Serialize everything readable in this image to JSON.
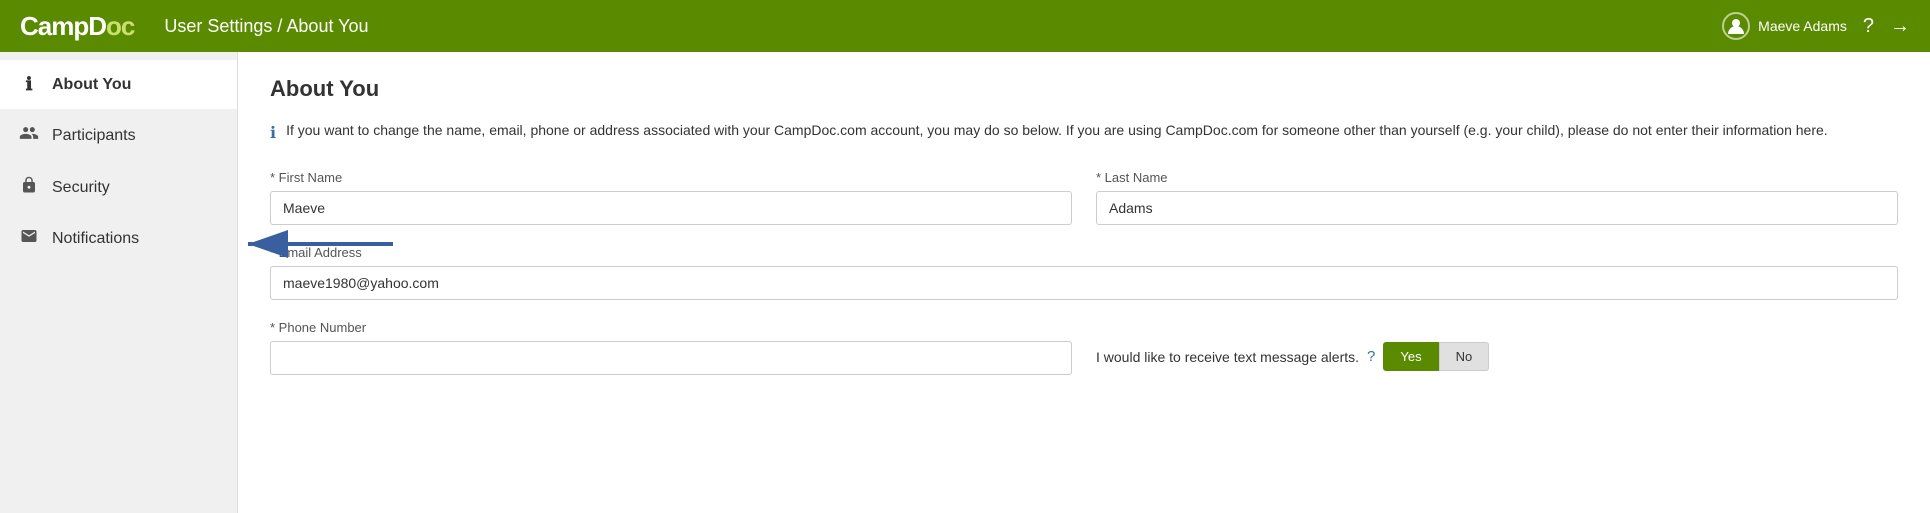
{
  "header": {
    "logo_camp": "CampD",
    "logo_doc": "oc",
    "logo_full": "CampDoc",
    "breadcrumb": "User Settings / About You",
    "user_name": "Maeve Adams",
    "help_icon": "?",
    "logout_icon": "→"
  },
  "sidebar": {
    "items": [
      {
        "id": "about-you",
        "label": "About You",
        "icon": "ℹ",
        "active": true
      },
      {
        "id": "participants",
        "label": "Participants",
        "icon": "👥",
        "active": false
      },
      {
        "id": "security",
        "label": "Security",
        "icon": "🔒",
        "active": false
      },
      {
        "id": "notifications",
        "label": "Notifications",
        "icon": "✉",
        "active": false
      }
    ]
  },
  "main": {
    "page_title": "About You",
    "info_text": "If you want to change the name, email, phone or address associated with your CampDoc.com account, you may do so below. If you are using CampDoc.com for someone other than yourself (e.g. your child), please do not enter their information here.",
    "form": {
      "first_name_label": "* First Name",
      "first_name_value": "Maeve",
      "last_name_label": "* Last Name",
      "last_name_value": "Adams",
      "email_label": "* Email Address",
      "email_value": "maeve1980@yahoo.com",
      "phone_label": "* Phone Number",
      "phone_value": "",
      "text_alert_label": "I would like to receive text message alerts.",
      "toggle_yes": "Yes",
      "toggle_no": "No"
    }
  }
}
